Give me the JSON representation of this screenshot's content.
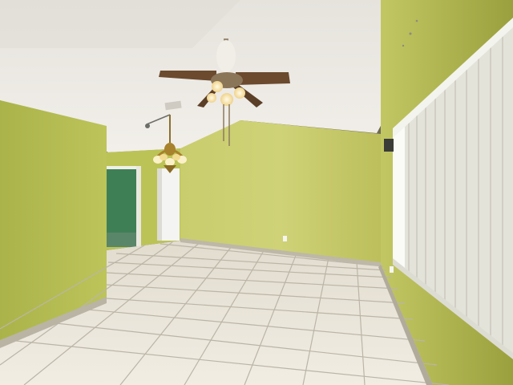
{
  "scene": {
    "description_tags": [
      "empty-room",
      "lime-green-walls",
      "vaulted-ceiling",
      "ceiling-fan",
      "chandelier",
      "vertical-blinds",
      "tile-floor"
    ],
    "colors": {
      "ceiling": "#efece6",
      "wall_left": "#b9c257",
      "wall_back": "#c6cb6a",
      "wall_right": "#b7bd55",
      "floor_tile": "#ece8dc",
      "grout": "#b8b2a4",
      "blinds": "#f3f3ee",
      "baseboard": "#bdb8a8",
      "doorway_green": "#3f7f56",
      "door_white": "#f4f4f2",
      "fan_blade": "#6b4a2e",
      "fan_light": "#f7e7b2",
      "chandelier_brass": "#a8822c"
    }
  }
}
